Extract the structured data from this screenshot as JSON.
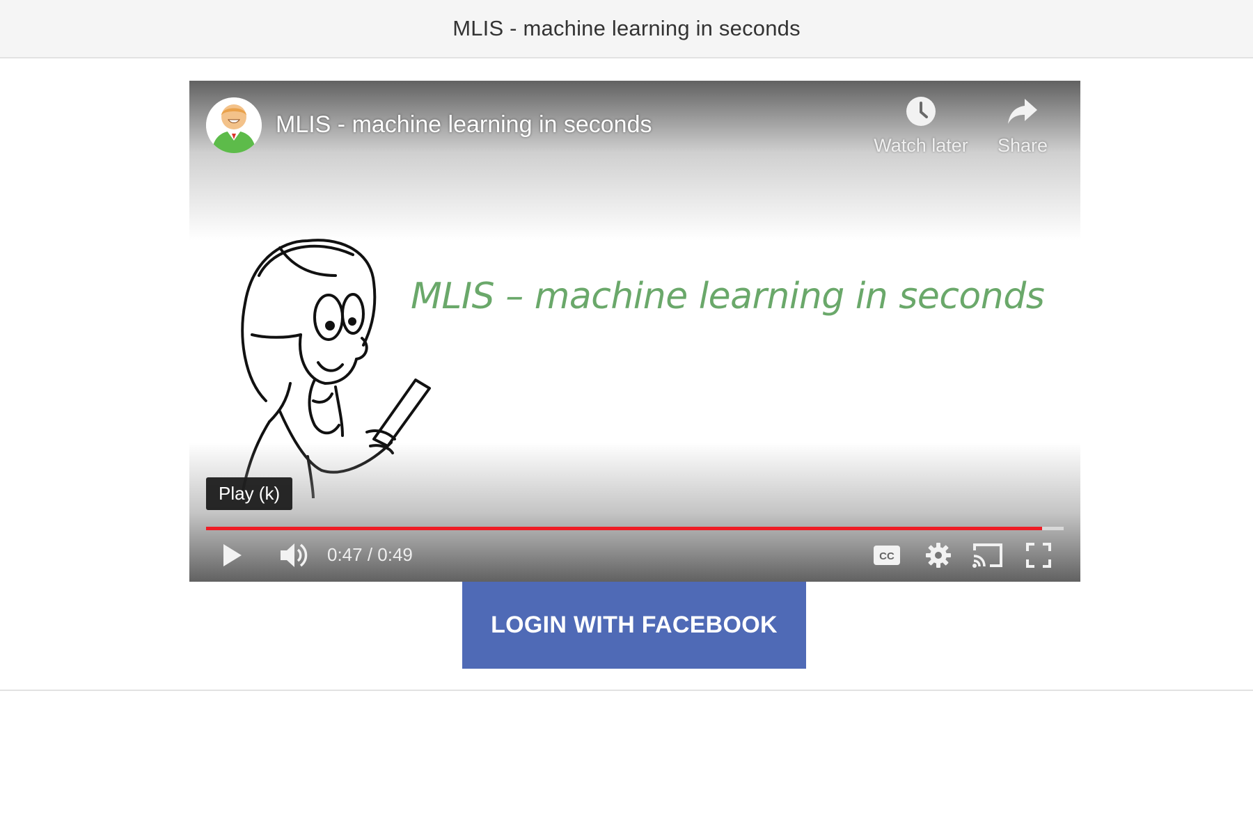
{
  "header": {
    "title": "MLIS - machine learning in seconds"
  },
  "video": {
    "title": "MLIS - machine learning in seconds",
    "overlay_text": "MLIS – machine learning in seconds",
    "actions": {
      "watch_later": "Watch later",
      "share": "Share"
    },
    "tooltip": "Play (k)",
    "current_time": "0:47",
    "duration": "0:49",
    "time_display": "0:47 / 0:49",
    "progress": 0.975,
    "overlay_text_color": "#6aa86a",
    "progress_color": "#ee1c25",
    "icons": {
      "avatar": "channel-avatar-icon",
      "watch_later": "clock-icon",
      "share": "share-arrow-icon",
      "play": "play-icon",
      "volume": "volume-icon",
      "captions": "cc-icon",
      "settings": "gear-icon",
      "cast": "cast-icon",
      "fullscreen": "fullscreen-icon"
    }
  },
  "login": {
    "button_label": "LOGIN WITH FACEBOOK",
    "color": "#4f6ab6"
  }
}
